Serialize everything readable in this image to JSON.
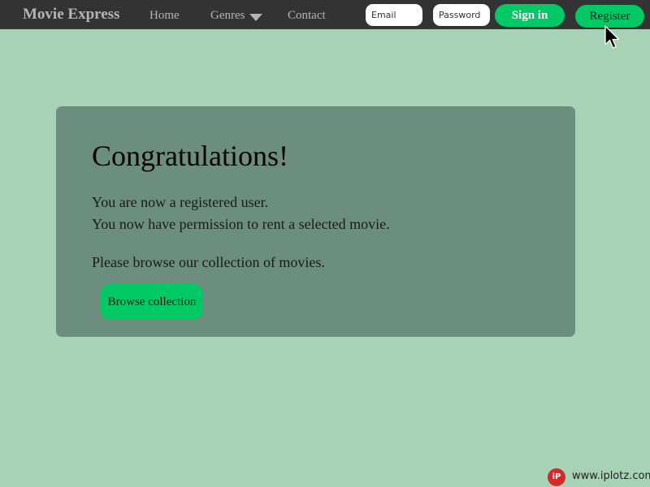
{
  "nav": {
    "brand": "Movie Express",
    "home": "Home",
    "genres": "Genres",
    "contact": "Contact",
    "genres_icon": "caret-down-icon"
  },
  "auth": {
    "email_placeholder": "Email",
    "password_placeholder": "Password",
    "signin_label": "Sign in",
    "register_label": "Register"
  },
  "main": {
    "heading": "Congratulations!",
    "line1": "You are now a registered user.",
    "line2": "You now have permission to rent a selected movie.",
    "line3": "Please browse our collection of movies.",
    "browse_label": "Browse collection"
  },
  "watermark": {
    "logo": "iP",
    "text": "www.iplotz.com"
  },
  "colors": {
    "background": "#a8d2b6",
    "navbar": "#333333",
    "panel": "#6b8e7f",
    "accent": "#00c864"
  }
}
